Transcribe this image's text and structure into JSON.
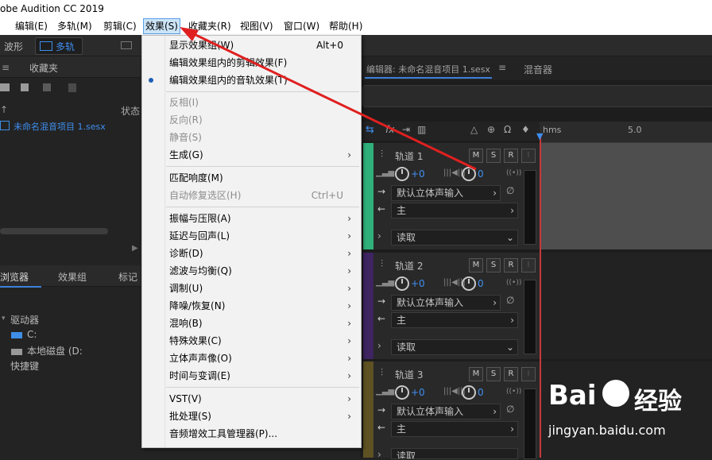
{
  "titlebar": {
    "title": "obe Audition CC 2019"
  },
  "menubar": {
    "items": [
      {
        "label": "编辑(E)"
      },
      {
        "label": "多轨(M)"
      },
      {
        "label": "剪辑(C)"
      },
      {
        "label": "效果(S)"
      },
      {
        "label": "收藏夹(R)"
      },
      {
        "label": "视图(V)"
      },
      {
        "label": "窗口(W)"
      },
      {
        "label": "帮助(H)"
      }
    ]
  },
  "toolbar": {
    "waveform": "波形",
    "multitrack": "多轨"
  },
  "files_panel": {
    "tab_favorites": "收藏夹",
    "col_status": "状态",
    "file_name": "未命名混音项目 1.sesx"
  },
  "media_panel": {
    "tab_browser": "浏览器",
    "tab_effects_group": "效果组",
    "tab_markers": "标记",
    "drives": "驱动器",
    "drive_c": "C:",
    "drive_d": "本地磁盘 (D:",
    "shortcuts": "快捷键"
  },
  "effects_menu": {
    "items": [
      {
        "label": "显示效果组(W)",
        "shortcut": "Alt+0"
      },
      {
        "label": "编辑效果组内的剪辑效果(F)"
      },
      {
        "label": "编辑效果组内的音轨效果(T)"
      },
      {
        "label": "反相(I)"
      },
      {
        "label": "反向(R)"
      },
      {
        "label": "静音(S)"
      },
      {
        "label": "生成(G)"
      },
      {
        "label": "匹配响度(M)"
      },
      {
        "label": "自动修复选区(H)",
        "shortcut": "Ctrl+U"
      },
      {
        "label": "振幅与压限(A)"
      },
      {
        "label": "延迟与回声(L)"
      },
      {
        "label": "诊断(D)"
      },
      {
        "label": "滤波与均衡(Q)"
      },
      {
        "label": "调制(U)"
      },
      {
        "label": "降噪/恢复(N)"
      },
      {
        "label": "混响(B)"
      },
      {
        "label": "特殊效果(C)"
      },
      {
        "label": "立体声声像(O)"
      },
      {
        "label": "时间与变调(E)"
      },
      {
        "label": "VST(V)"
      },
      {
        "label": "批处理(S)"
      },
      {
        "label": "音频增效工具管理器(P)..."
      }
    ]
  },
  "editor": {
    "tab_editor": "编辑器: 未命名混音项目 1.sesx",
    "tab_mixer": "混音器",
    "ruler_hms": "hms",
    "ruler_5": "5.0"
  },
  "tracks": [
    {
      "name": "轨道 1",
      "volume": "+0",
      "pan": "0",
      "input": "默认立体声输入",
      "output": "主",
      "automation": "读取",
      "color": "#2fb07a"
    },
    {
      "name": "轨道 2",
      "volume": "+0",
      "pan": "0",
      "input": "默认立体声输入",
      "output": "主",
      "automation": "读取",
      "color": "#3e2461"
    },
    {
      "name": "轨道 3",
      "volume": "+0",
      "pan": "0",
      "input": "默认立体声输入",
      "output": "主",
      "automation": "读取",
      "color": "#5e5122"
    }
  ],
  "track_buttons": {
    "m": "M",
    "s": "S",
    "r": "R",
    "i": "I"
  },
  "watermark": {
    "brand": "Bai",
    "brand2": "经验",
    "url": "jingyan.baidu.com"
  },
  "colors": {
    "accent": "#3e7fd8",
    "arrow": "#e02020",
    "playhead": "#c43a3a"
  }
}
